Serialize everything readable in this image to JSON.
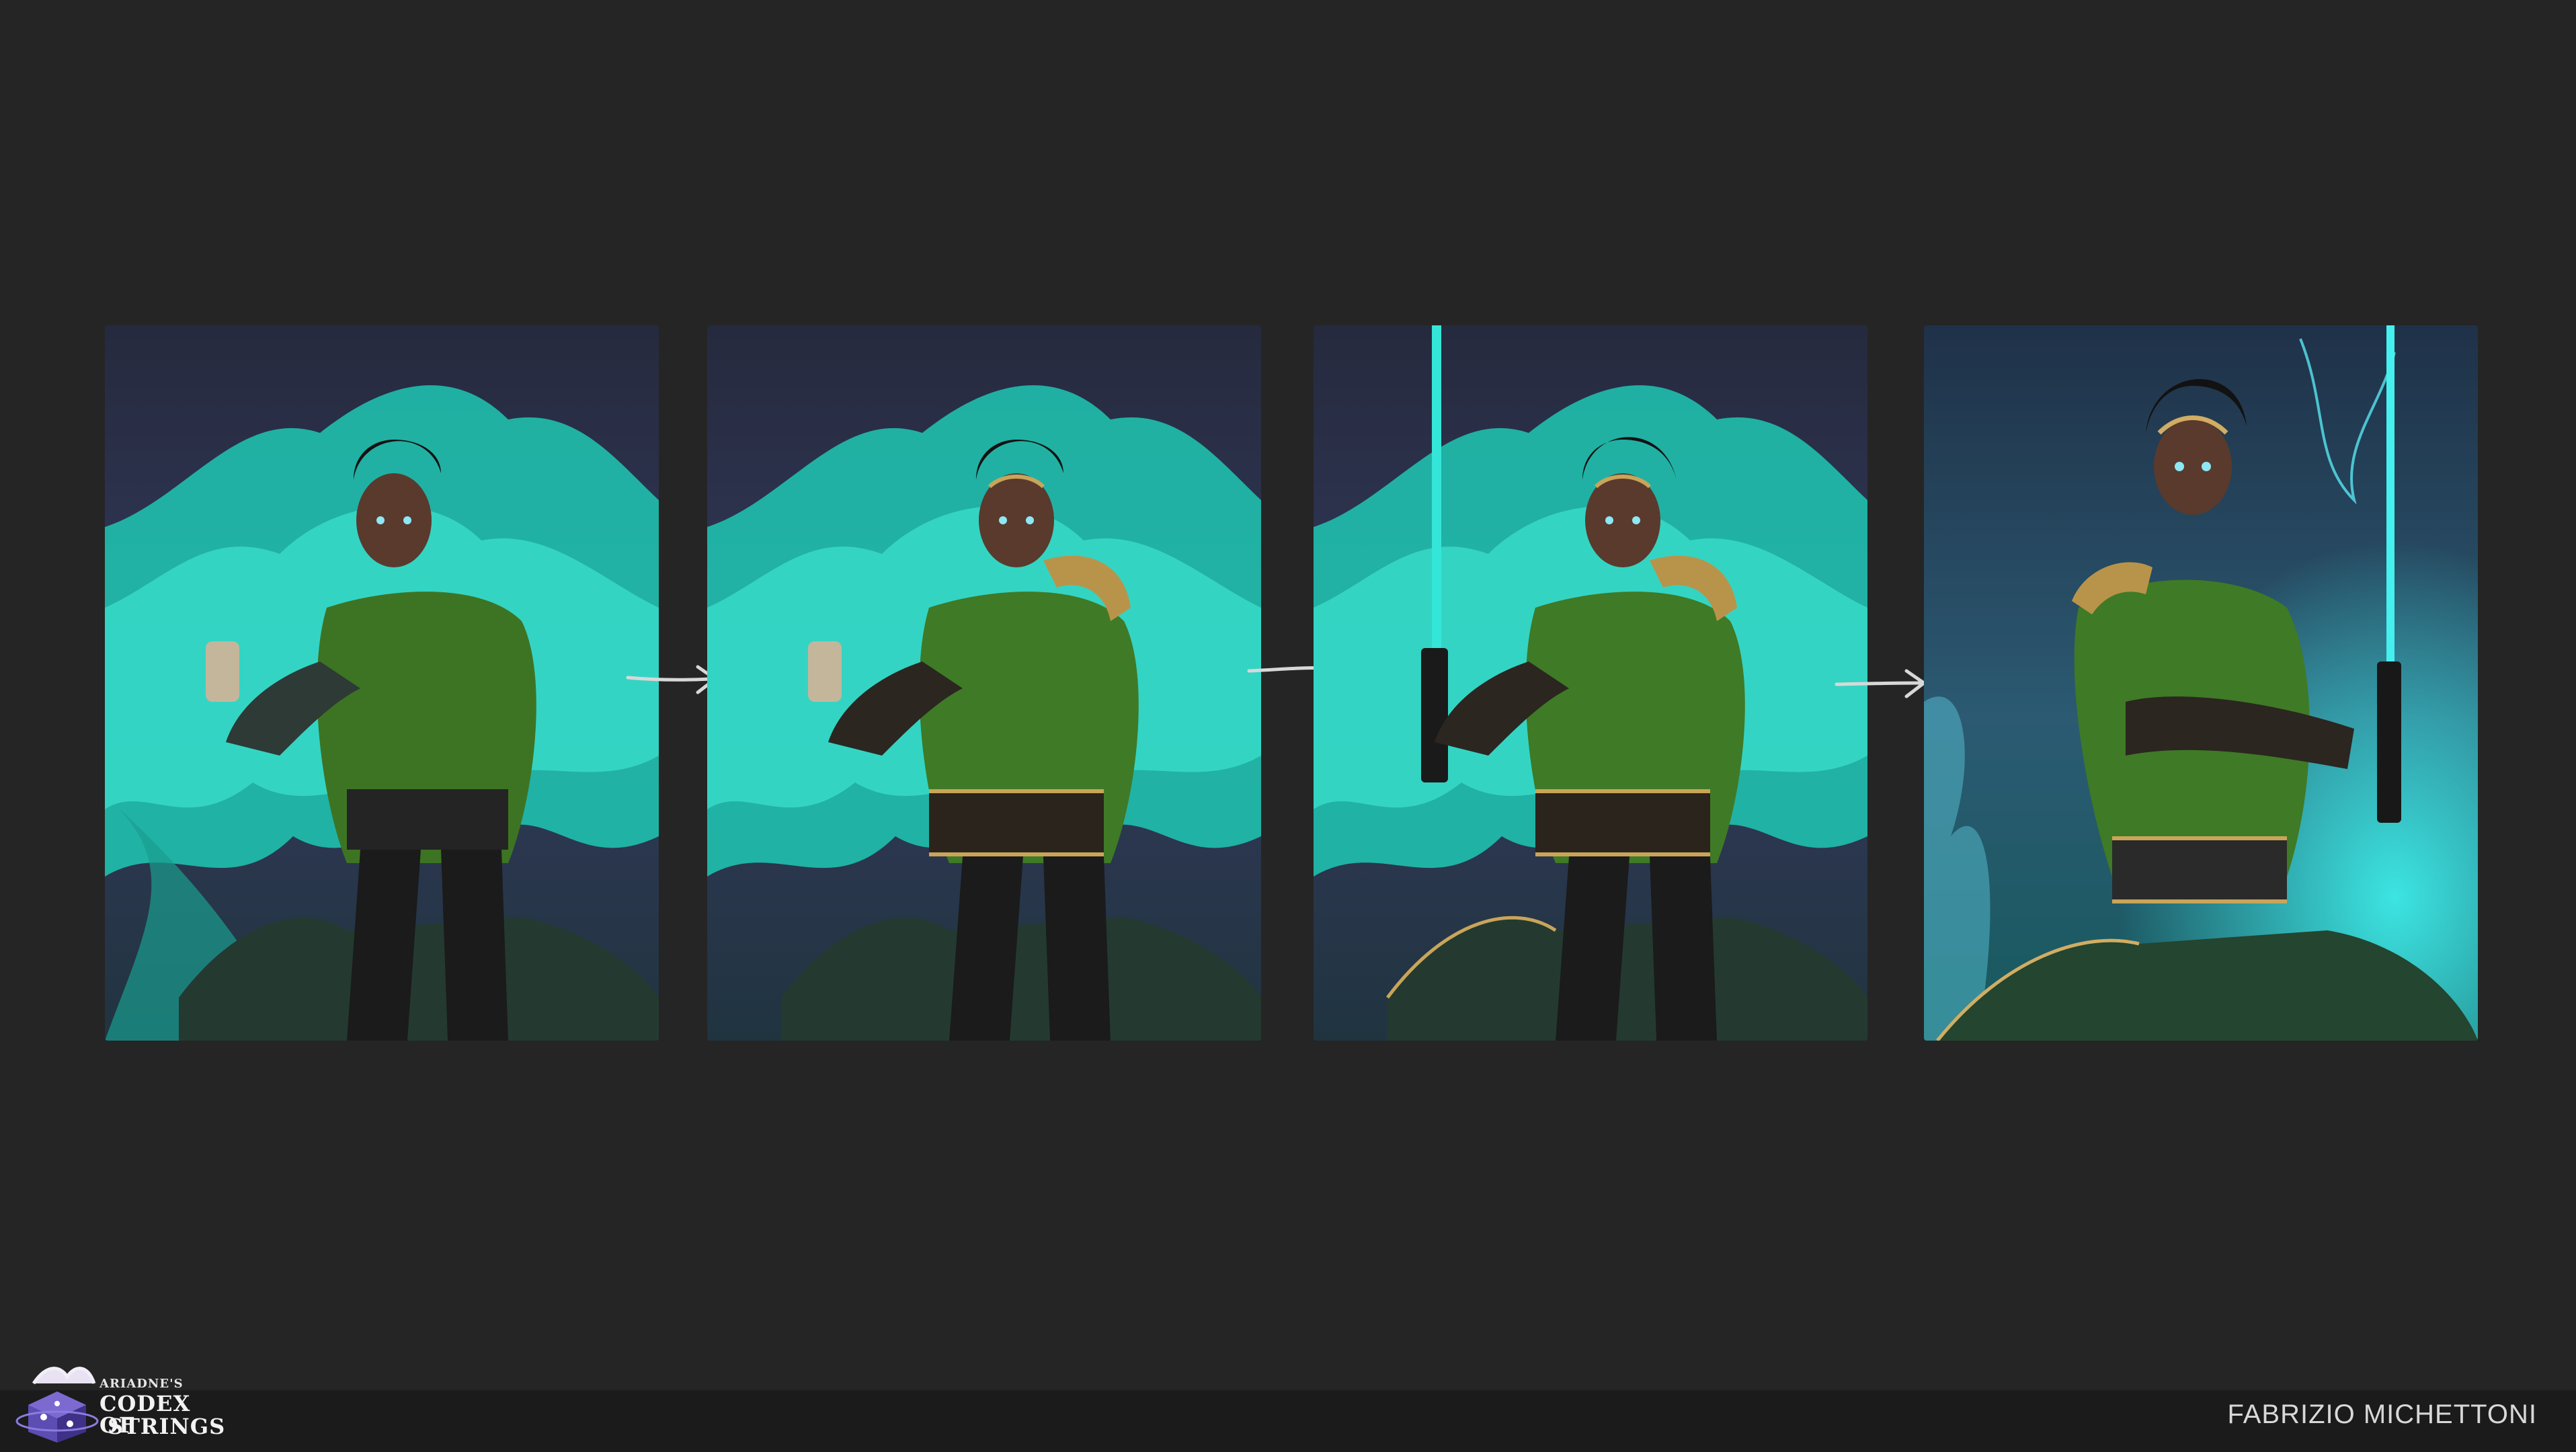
{
  "canvas": {
    "background": "#252525",
    "footer_background": "#1b1b1b"
  },
  "panels": [
    {
      "name": "stage-1",
      "description_icon": "character-sketch-image"
    },
    {
      "name": "stage-2",
      "description_icon": "character-detail-image"
    },
    {
      "name": "stage-3",
      "description_icon": "character-sword-image"
    },
    {
      "name": "stage-4",
      "description_icon": "character-final-image"
    }
  ],
  "arrows": [
    "arrow-right-icon",
    "arrow-right-icon",
    "arrow-right-icon"
  ],
  "logo": {
    "small": "ARIADNE'S",
    "line1": "CODEX OF",
    "line2": "STRINGS",
    "icon": "book-cube-icon"
  },
  "footer": {
    "artist": "FABRIZIO MICHETTONI"
  },
  "colors": {
    "aura": "#2de0c8",
    "coat_green": "#3f7a26",
    "night_sky": "#2b2f45"
  }
}
